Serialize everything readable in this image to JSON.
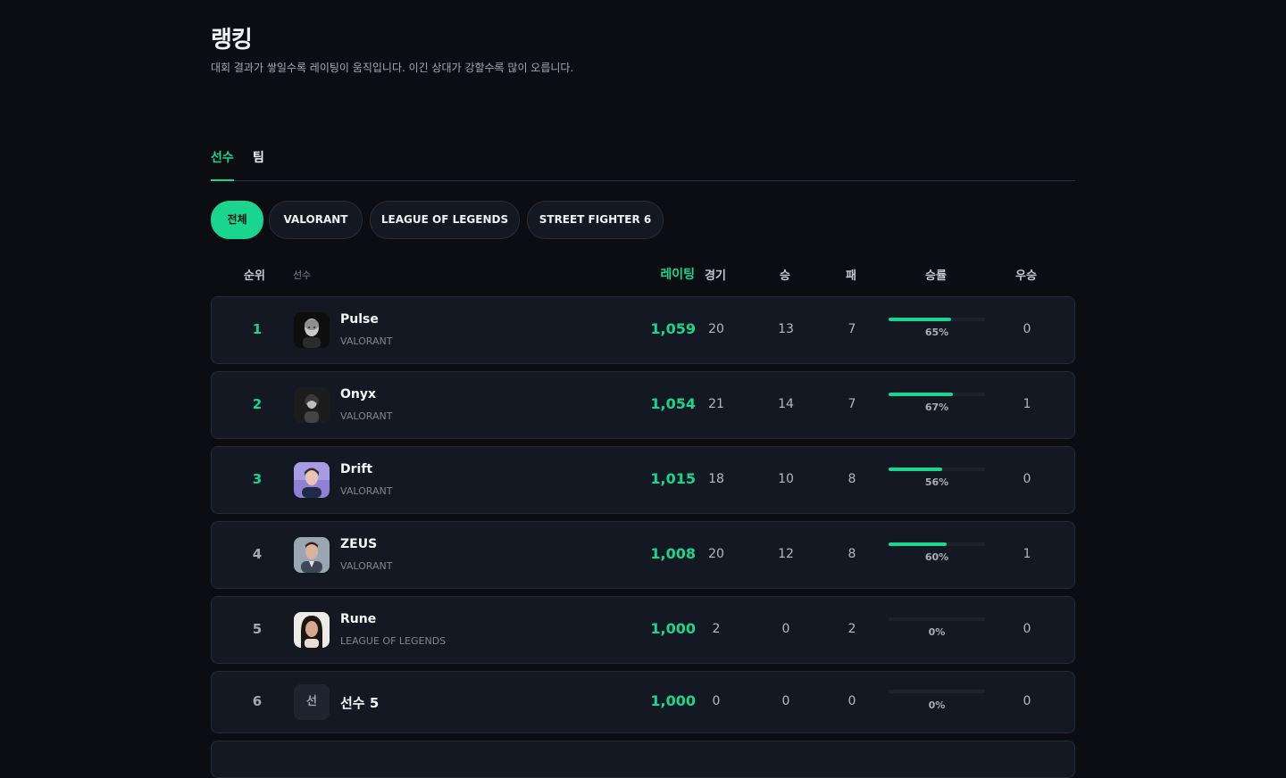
{
  "page": {
    "title": "랭킹",
    "subtitle": "대회 결과가 쌓일수록 레이팅이 움직입니다. 이긴 상대가 강할수록 많이 오릅니다."
  },
  "tabs": [
    {
      "label": "선수",
      "active": true
    },
    {
      "label": "팀",
      "active": false
    }
  ],
  "filters": [
    {
      "label": "전체",
      "active": true
    },
    {
      "label": "VALORANT",
      "active": false
    },
    {
      "label": "LEAGUE OF LEGENDS",
      "active": false
    },
    {
      "label": "STREET FIGHTER 6",
      "active": false
    }
  ],
  "table": {
    "headers": {
      "rank": "순위",
      "player": "선수",
      "rating": "레이팅",
      "games": "경기",
      "wins": "승",
      "losses": "패",
      "winrate": "승률",
      "champ": "우승"
    },
    "rows": [
      {
        "rank": "1",
        "name": "Pulse",
        "game": "VALORANT",
        "rating": "1,059",
        "games": "20",
        "wins": "13",
        "losses": "7",
        "winrate_label": "65%",
        "winrate": 0.65,
        "champ": "0"
      },
      {
        "rank": "2",
        "name": "Onyx",
        "game": "VALORANT",
        "rating": "1,054",
        "games": "21",
        "wins": "14",
        "losses": "7",
        "winrate_label": "67%",
        "winrate": 0.67,
        "champ": "1"
      },
      {
        "rank": "3",
        "name": "Drift",
        "game": "VALORANT",
        "rating": "1,015",
        "games": "18",
        "wins": "10",
        "losses": "8",
        "winrate_label": "56%",
        "winrate": 0.56,
        "champ": "0"
      },
      {
        "rank": "4",
        "name": "ZEUS",
        "game": "VALORANT",
        "rating": "1,008",
        "games": "20",
        "wins": "12",
        "losses": "8",
        "winrate_label": "60%",
        "winrate": 0.6,
        "champ": "1"
      },
      {
        "rank": "5",
        "name": "Rune",
        "game": "LEAGUE OF LEGENDS",
        "rating": "1,000",
        "games": "2",
        "wins": "0",
        "losses": "2",
        "winrate_label": "0%",
        "winrate": 0.0,
        "champ": "0"
      },
      {
        "rank": "6",
        "name": "선수 5",
        "game": "",
        "avatar_initial": "선",
        "rating": "1,000",
        "games": "0",
        "wins": "0",
        "losses": "0",
        "winrate_label": "0%",
        "winrate": 0.0,
        "champ": "0"
      }
    ]
  },
  "colors": {
    "accent": "#19d58e",
    "background": "#0b0d12",
    "row_background": "#131822"
  }
}
